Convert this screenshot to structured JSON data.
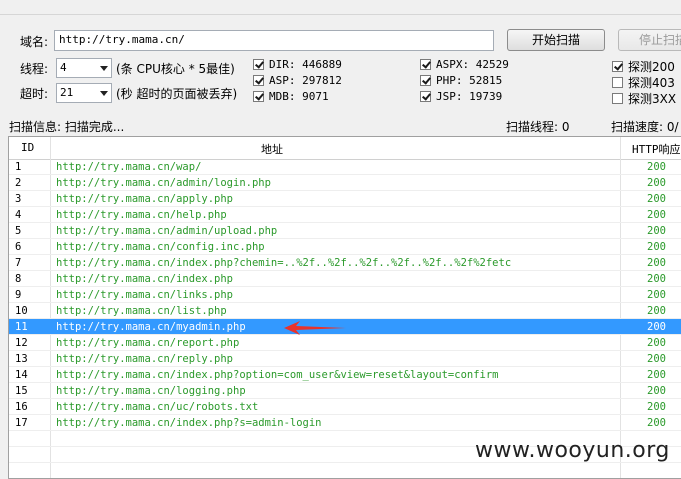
{
  "form": {
    "domain_label": "域名:",
    "domain_value": "http://try.mama.cn/",
    "threads_label": "线程:",
    "threads_value": "4",
    "threads_hint": "(条 CPU核心 * 5最佳)",
    "timeout_label": "超时:",
    "timeout_value": "21",
    "timeout_hint": "(秒 超时的页面被丢弃)",
    "start_button": "开始扫描",
    "stop_button": "停止扫描"
  },
  "dict_checks": [
    {
      "label": "DIR: 446889",
      "checked": true
    },
    {
      "label": "ASP: 297812",
      "checked": true
    },
    {
      "label": "MDB: 9071",
      "checked": true
    },
    {
      "label": "ASPX: 42529",
      "checked": true
    },
    {
      "label": "PHP: 52815",
      "checked": true
    },
    {
      "label": "JSP: 19739",
      "checked": true
    }
  ],
  "probe_checks": [
    {
      "label": "探测200",
      "checked": true
    },
    {
      "label": "探测403",
      "checked": false
    },
    {
      "label": "探测3XX",
      "checked": false
    }
  ],
  "status": {
    "info": "扫描信息: 扫描完成...",
    "threads": "扫描线程: 0",
    "speed": "扫描速度: 0/"
  },
  "table": {
    "columns": [
      "ID",
      "地址",
      "HTTP响应"
    ],
    "selected_index": 10,
    "rows": [
      {
        "id": "1",
        "url": "http://try.mama.cn/wap/",
        "code": "200"
      },
      {
        "id": "2",
        "url": "http://try.mama.cn/admin/login.php",
        "code": "200"
      },
      {
        "id": "3",
        "url": "http://try.mama.cn/apply.php",
        "code": "200"
      },
      {
        "id": "4",
        "url": "http://try.mama.cn/help.php",
        "code": "200"
      },
      {
        "id": "5",
        "url": "http://try.mama.cn/admin/upload.php",
        "code": "200"
      },
      {
        "id": "6",
        "url": "http://try.mama.cn/config.inc.php",
        "code": "200"
      },
      {
        "id": "7",
        "url": "http://try.mama.cn/index.php?chemin=..%2f..%2f..%2f..%2f..%2f..%2f%2fetc",
        "code": "200"
      },
      {
        "id": "8",
        "url": "http://try.mama.cn/index.php",
        "code": "200"
      },
      {
        "id": "9",
        "url": "http://try.mama.cn/links.php",
        "code": "200"
      },
      {
        "id": "10",
        "url": "http://try.mama.cn/list.php",
        "code": "200"
      },
      {
        "id": "11",
        "url": "http://try.mama.cn/myadmin.php",
        "code": "200"
      },
      {
        "id": "12",
        "url": "http://try.mama.cn/report.php",
        "code": "200"
      },
      {
        "id": "13",
        "url": "http://try.mama.cn/reply.php",
        "code": "200"
      },
      {
        "id": "14",
        "url": "http://try.mama.cn/index.php?option=com_user&view=reset&layout=confirm",
        "code": "200"
      },
      {
        "id": "15",
        "url": "http://try.mama.cn/logging.php",
        "code": "200"
      },
      {
        "id": "16",
        "url": "http://try.mama.cn/uc/robots.txt",
        "code": "200"
      },
      {
        "id": "17",
        "url": "http://try.mama.cn/index.php?s=admin-login",
        "code": "200"
      }
    ]
  },
  "watermark": "www.wooyun.org",
  "colors": {
    "url_green": "#2b9a2b",
    "selection": "#3399ff",
    "annotation_arrow": "#e8332b"
  }
}
